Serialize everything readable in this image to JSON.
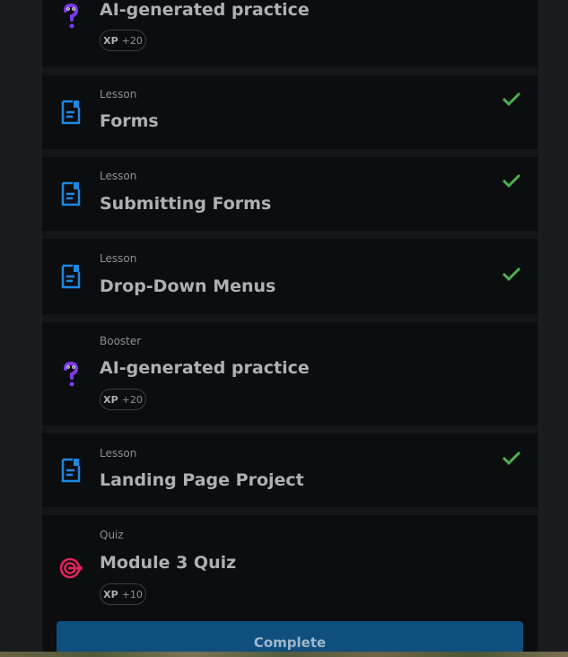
{
  "items": [
    {
      "kind": "",
      "title": "AI-generated practice",
      "xp_label": "XP",
      "xp_value": "+20",
      "completed": false,
      "icon": "question-mark-icon"
    },
    {
      "kind": "Lesson",
      "title": "Forms",
      "completed": true,
      "icon": "lesson-document-icon"
    },
    {
      "kind": "Lesson",
      "title": "Submitting Forms",
      "completed": true,
      "icon": "lesson-document-icon"
    },
    {
      "kind": "Lesson",
      "title": "Drop-Down Menus",
      "completed": true,
      "icon": "lesson-document-icon"
    },
    {
      "kind": "Booster",
      "title": "AI-generated practice",
      "xp_label": "XP",
      "xp_value": "+20",
      "completed": false,
      "icon": "question-mark-icon"
    },
    {
      "kind": "Lesson",
      "title": "Landing Page Project",
      "completed": true,
      "icon": "lesson-document-icon"
    },
    {
      "kind": "Quiz",
      "title": "Module 3 Quiz",
      "xp_label": "XP",
      "xp_value": "+10",
      "completed": false,
      "icon": "target-icon"
    }
  ],
  "complete_button": {
    "label": "Complete"
  },
  "colors": {
    "lesson_icon": "#1e88e5",
    "booster_icon": "#7c3aed",
    "quiz_icon": "#e0245e",
    "check": "#4caf50",
    "button": "#0f4f7f"
  }
}
